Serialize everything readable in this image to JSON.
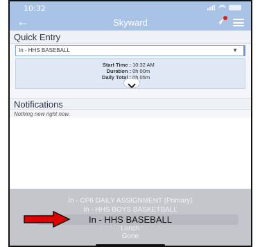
{
  "status": {
    "time": "10:32"
  },
  "header": {
    "title": "Skyward"
  },
  "quick_entry": {
    "title": "Quick Entry",
    "selected": "In - HHS BASEBALL",
    "details": [
      {
        "label": "Start Time :",
        "value": "10:32 AM"
      },
      {
        "label": "Duration :",
        "value": "0h 00m"
      },
      {
        "label": "Daily Total :",
        "value": "0h 05m"
      }
    ]
  },
  "notifications": {
    "title": "Notifications",
    "empty_text": "Nothing new right now."
  },
  "picker": {
    "options": [
      "In - CP6 DAILY ASSIGNMENT (Primary)",
      "In - HHS BOYS BASKETBALL",
      "In - HHS BASEBALL",
      "Lunch",
      "Gone"
    ],
    "selected_index": 2
  },
  "colors": {
    "header": "#a9c3e6",
    "arrow": "#e00000",
    "notify_dot": "#e21b1b"
  },
  "icons": [
    "back-arrow-icon",
    "send-icon",
    "menu-icon",
    "chevron-down-icon",
    "signal-icon",
    "wifi-icon",
    "battery-icon"
  ]
}
